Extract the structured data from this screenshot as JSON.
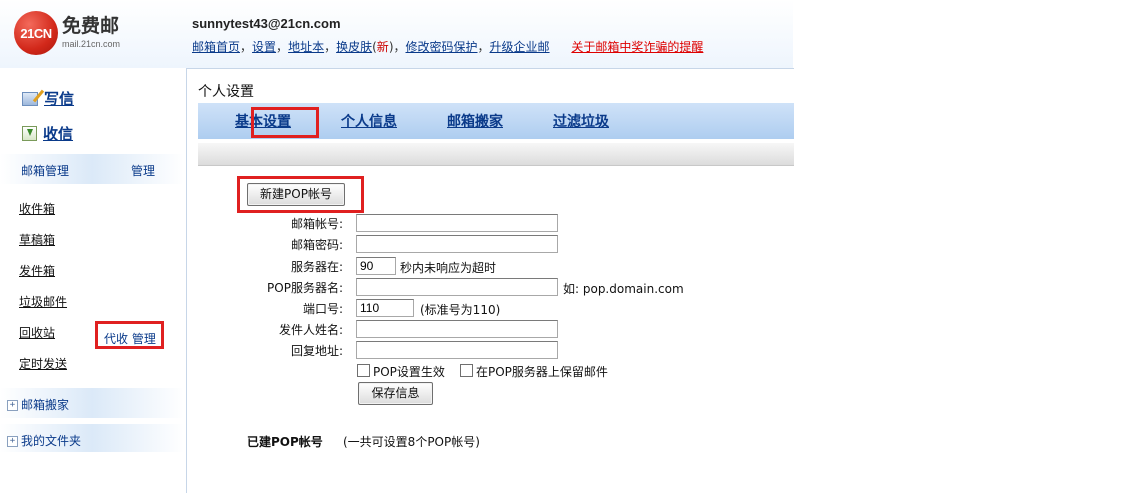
{
  "header": {
    "logo_badge": "21CN",
    "logo_title": "免费邮",
    "logo_sub": "mail.21cn.com",
    "account": "sunnytest43@21cn.com",
    "links": [
      "邮箱首页",
      "设置",
      "地址本",
      "换皮肤",
      "新",
      "修改密码保护",
      "升级企业邮"
    ],
    "warning_link": "关于邮箱中奖诈骗的提醒"
  },
  "sidebar": {
    "compose": "写信",
    "receive": "收信",
    "mailbox_manage": "邮箱管理",
    "manage": "管理",
    "folders": [
      "收件箱",
      "草稿箱",
      "发件箱",
      "垃圾邮件",
      "回收站",
      "定时发送"
    ],
    "mail_move": "邮箱搬家",
    "proxy": "代收",
    "proxy_manage": "管理",
    "my_files": "我的文件夹"
  },
  "main": {
    "title": "个人设置",
    "tabs": [
      "基本设置",
      "个人信息",
      "邮箱搬家",
      "过滤垃圾"
    ],
    "active_tab": "邮箱搬家",
    "new_pop_button": "新建POP帐号",
    "form": {
      "account_label": "邮箱帐号:",
      "account_value": "",
      "password_label": "邮箱密码:",
      "password_value": "",
      "timeout_label": "服务器在:",
      "timeout_value": "90",
      "timeout_suffix": "秒内未响应为超时",
      "pop_server_label": "POP服务器名:",
      "pop_server_value": "",
      "pop_server_example": "如: pop.domain.com",
      "port_label": "端口号:",
      "port_value": "110",
      "port_note": "(标准号为110)",
      "sender_label": "发件人姓名:",
      "sender_value": "",
      "reply_label": "回复地址:",
      "reply_value": "",
      "pop_enable": "POP设置生效",
      "keep_on_server": "在POP服务器上保留邮件",
      "save_button": "保存信息"
    },
    "existing_title": "已建POP帐号",
    "existing_note": "(一共可设置8个POP帐号)"
  },
  "colors": {
    "link": "#0a3a8a",
    "highlight_box": "#e02020",
    "tab_bar": "#b9d5f3",
    "warning": "#dd0000"
  }
}
